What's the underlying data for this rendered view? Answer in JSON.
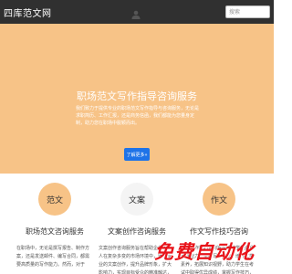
{
  "navbar": {
    "brand": "四库范文网",
    "search_placeholder": "搜索"
  },
  "hero": {
    "title": "职场范文写作指导咨询服务",
    "description": "我们致力于提供专业的职场范文写作指导与咨询服务，无论是求职简历、工作汇报，还是商务信函，我们都能为您量身定制，助力您在职场中脱颖而出。",
    "button_label": "了解更多»",
    "background_color": "#f7c387",
    "button_color": "#1e73e8"
  },
  "features": [
    {
      "icon_label": "范文",
      "color": "#f7c387",
      "title": "职场范文咨询服务",
      "description": "在职场中，无论是撰写报告、制作方案，还是发送邮件、编写合同，都需要高质量的写作能力。然而，对于"
    },
    {
      "icon_label": "文案",
      "color": "#f4f4f4",
      "title": "文案创作咨询服务",
      "description": "文案创作咨询服务旨在帮助企业和个人在复杂多变的市场环境中，通过专业的文案创作，提升品牌形象，扩大影响力，实现目标受众的精准触达，使文案深入人心，登"
    },
    {
      "icon_label": "作文",
      "color": "#f7c387",
      "title": "作文写作技巧咨询",
      "description": "作文写作技巧咨询旨在帮助学生提升写作能力，掌握写作方法，培养文学素养，拓展知识视野，助力学生在考试中取得优异成绩，掌握写作技巧，提高作文水平，成为写作高手，写出"
    }
  ],
  "watermark": {
    "text": "免费自动化",
    "color": "#e8141b"
  }
}
